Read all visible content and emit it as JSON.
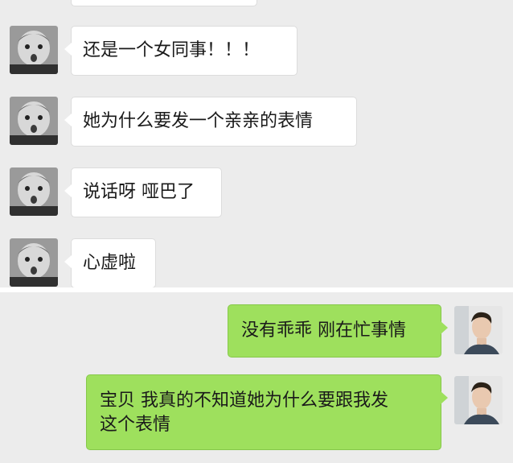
{
  "chat": {
    "top_messages": [
      {
        "sender": "baby-avatar",
        "text": ""
      },
      {
        "sender": "baby-avatar",
        "text": "还是一个女同事！！！"
      },
      {
        "sender": "baby-avatar",
        "text": "她为什么要发一个亲亲的表情"
      },
      {
        "sender": "baby-avatar",
        "text": "说话呀 哑巴了"
      },
      {
        "sender": "baby-avatar",
        "text": "心虚啦"
      }
    ],
    "bottom_messages": [
      {
        "sender": "man-avatar",
        "text": "没有乖乖 刚在忙事情"
      },
      {
        "sender": "man-avatar",
        "text": "宝贝 我真的不知道她为什么要跟我发\n这个表情"
      }
    ]
  },
  "colors": {
    "background": "#ececec",
    "incoming_bubble": "#ffffff",
    "outgoing_bubble": "#9ee05d",
    "divider": "#ffffff"
  }
}
